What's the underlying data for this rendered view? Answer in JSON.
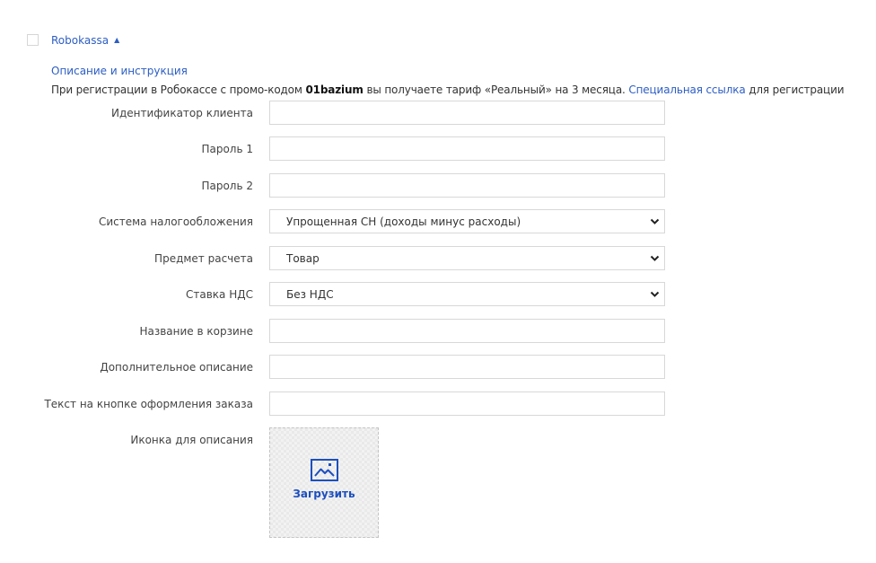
{
  "module": {
    "name": "Robokassa",
    "toggle_icon": "caret-up-icon",
    "checked": false
  },
  "description": {
    "link_label": "Описание и инструкция",
    "promo_before": "При регистрации в Робокассе с промо-кодом ",
    "promo_code": "01bazium",
    "promo_middle": " вы получаете тариф «Реальный» на 3 месяца. ",
    "special_link": "Специальная ссылка",
    "promo_after": " для регистрации"
  },
  "form": {
    "client_id": {
      "label": "Идентификатор клиента",
      "value": ""
    },
    "password1": {
      "label": "Пароль 1",
      "value": ""
    },
    "password2": {
      "label": "Пароль 2",
      "value": ""
    },
    "tax_system": {
      "label": "Система налогообложения",
      "value": "Упрощенная СН (доходы минус расходы)"
    },
    "payment_subject": {
      "label": "Предмет расчета",
      "value": "Товар"
    },
    "vat_rate": {
      "label": "Ставка НДС",
      "value": "Без НДС"
    },
    "cart_name": {
      "label": "Название в корзине",
      "value": ""
    },
    "extra_description": {
      "label": "Дополнительное описание",
      "value": ""
    },
    "checkout_button_text": {
      "label": "Текст на кнопке оформления заказа",
      "value": ""
    },
    "description_icon": {
      "label": "Иконка для описания",
      "upload_label": "Загрузить",
      "icon": "image-icon"
    }
  },
  "colors": {
    "link": "#2d5ec4",
    "upload_accent": "#1d4fbf",
    "border": "#d8d8d8"
  }
}
